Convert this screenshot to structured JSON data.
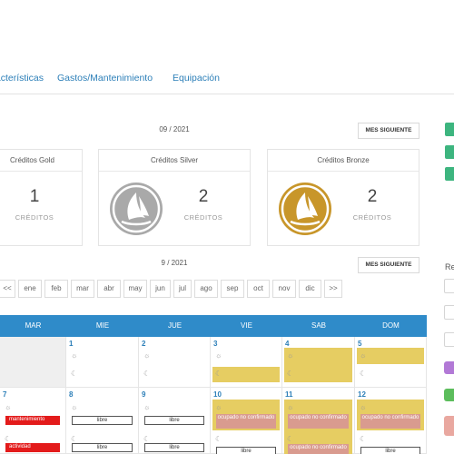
{
  "tabs": [
    "Características",
    "Gastos/Mantenimiento",
    "Equipación"
  ],
  "top_month": "09 / 2021",
  "next_month_button": "MES SIGUIENTE",
  "credits": [
    {
      "title": "Créditos Gold",
      "count": "1",
      "label": "CRÉDITOS"
    },
    {
      "title": "Créditos Silver",
      "count": "2",
      "label": "CRÉDITOS"
    },
    {
      "title": "Créditos Bronze",
      "count": "2",
      "label": "CRÉDITOS"
    }
  ],
  "calendar_month": "9 / 2021",
  "month_nav": [
    "<<",
    "ene",
    "feb",
    "mar",
    "abr",
    "may",
    "jun",
    "jul",
    "ago",
    "sep",
    "oct",
    "nov",
    "dic",
    ">>"
  ],
  "day_names": [
    "MAR",
    "MIE",
    "JUE",
    "VIE",
    "SAB",
    "DOM"
  ],
  "side_label": "Re",
  "week1": {
    "days": [
      "1",
      "2",
      "3",
      "4",
      "5"
    ]
  },
  "week2": {
    "days": [
      "7",
      "8",
      "9",
      "10",
      "11",
      "12"
    ],
    "mantenimiento": "mantenimiento",
    "actividad": "actividad",
    "libre": "libre",
    "ocupado": "ocupado no confirmado"
  },
  "colors": {
    "accent": "#2f8bc9",
    "occupied": "#e6cd62",
    "maintenance": "#e31b1b",
    "unconfirmed": "#d99b8f",
    "gold": "#c8962a",
    "silver": "#a7a7a7"
  },
  "icons": [
    "sun-icon",
    "moon-icon",
    "boat-icon"
  ]
}
